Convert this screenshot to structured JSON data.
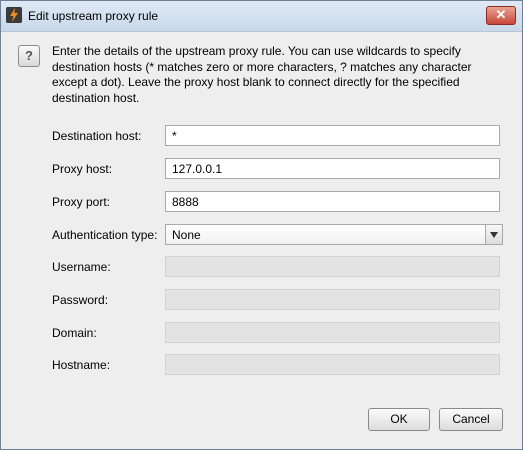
{
  "window": {
    "title": "Edit upstream proxy rule",
    "close_label": "✕"
  },
  "dialog": {
    "help_glyph": "?",
    "description": "Enter the details of the upstream proxy rule. You can use wildcards to specify destination hosts (* matches zero or more characters, ? matches any character except a dot). Leave the proxy host blank to connect directly for the specified destination host."
  },
  "form": {
    "destination_host": {
      "label": "Destination host:",
      "value": "*"
    },
    "proxy_host": {
      "label": "Proxy host:",
      "value": "127.0.0.1"
    },
    "proxy_port": {
      "label": "Proxy port:",
      "value": "8888"
    },
    "auth_type": {
      "label": "Authentication type:",
      "value": "None"
    },
    "username": {
      "label": "Username:",
      "value": ""
    },
    "password": {
      "label": "Password:",
      "value": ""
    },
    "domain": {
      "label": "Domain:",
      "value": ""
    },
    "hostname": {
      "label": "Hostname:",
      "value": ""
    }
  },
  "buttons": {
    "ok": "OK",
    "cancel": "Cancel"
  },
  "icons": {
    "app": "burp-lightning-icon",
    "help": "question-mark-icon"
  }
}
